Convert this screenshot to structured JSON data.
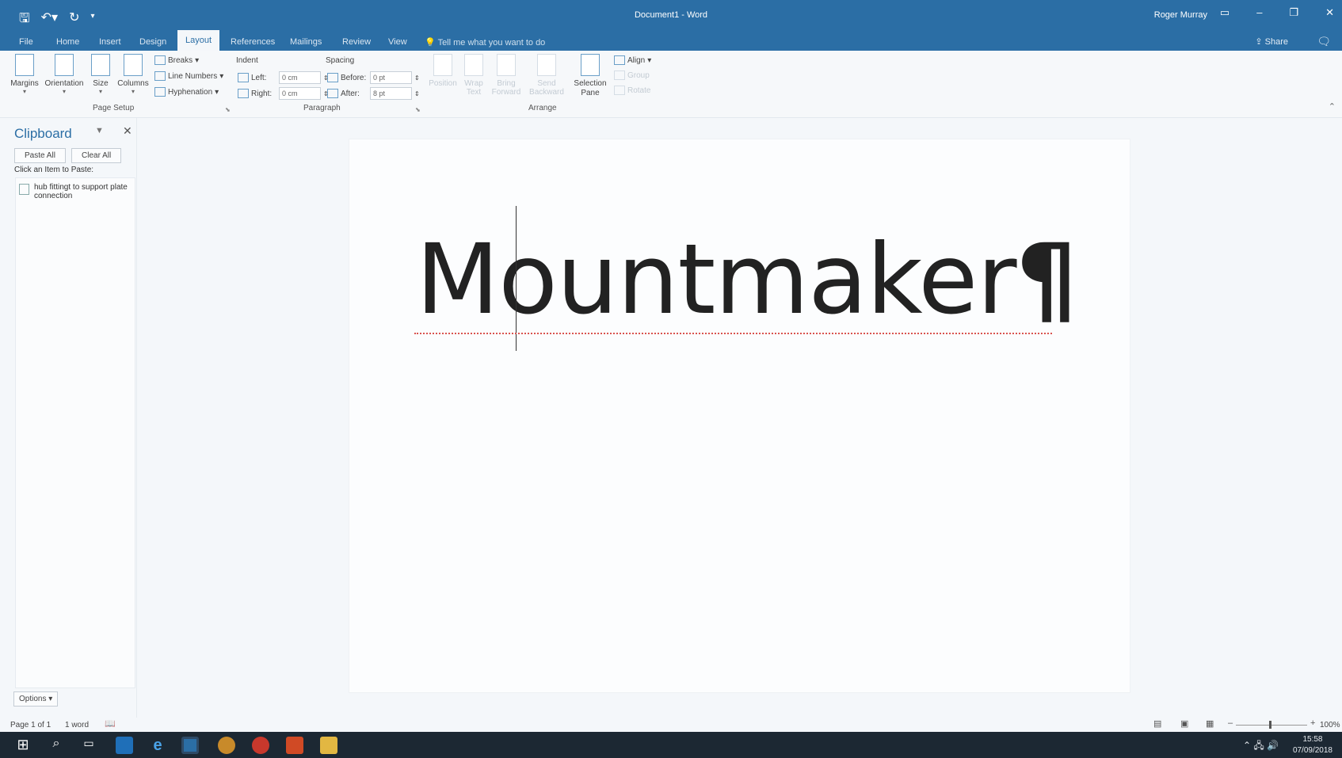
{
  "window": {
    "doc_title": "Document1 - Word",
    "user": "Roger Murray"
  },
  "qat": {
    "save_icon": "save-icon",
    "undo_icon": "undo-icon",
    "redo_icon": "redo-icon",
    "customize_icon": "customize-icon"
  },
  "tabs": [
    "File",
    "Home",
    "Insert",
    "Design",
    "Layout",
    "References",
    "Mailings",
    "Review",
    "View"
  ],
  "tellme": "Tell me what you want to do",
  "share": "Share",
  "ribbon": {
    "margins": "Margins",
    "orientation": "Orientation",
    "size": "Size",
    "columns": "Columns",
    "breaks": "Breaks",
    "line_numbers": "Line Numbers",
    "hyphenation": "Hyphenation",
    "page_setup": "Page Setup",
    "indent": "Indent",
    "left": "Left:",
    "left_val": "0 cm",
    "right": "Right:",
    "right_val": "0 cm",
    "spacing": "Spacing",
    "before": "Before:",
    "before_val": "0 pt",
    "after": "After:",
    "after_val": "8 pt",
    "paragraph": "Paragraph",
    "position": "Position",
    "wrap1": "Wrap",
    "wrap2": "Text",
    "bring1": "Bring",
    "bring2": "Forward",
    "send1": "Send",
    "send2": "Backward",
    "selection1": "Selection",
    "selection2": "Pane",
    "align": "Align",
    "group": "Group",
    "rotate": "Rotate",
    "arrange": "Arrange"
  },
  "clipboard": {
    "title": "Clipboard",
    "paste_all": "Paste All",
    "clear_all": "Clear All",
    "hint": "Click an Item to Paste:",
    "items": [
      "hub fittingt to support plate connection"
    ],
    "options": "Options"
  },
  "document": {
    "text": "Mountmaker",
    "pilcrow": "¶"
  },
  "status": {
    "page": "Page 1 of 1",
    "words": "1 word",
    "zoom": "100%"
  },
  "taskbar": {
    "time": "15:58",
    "date": "07/09/2018"
  }
}
